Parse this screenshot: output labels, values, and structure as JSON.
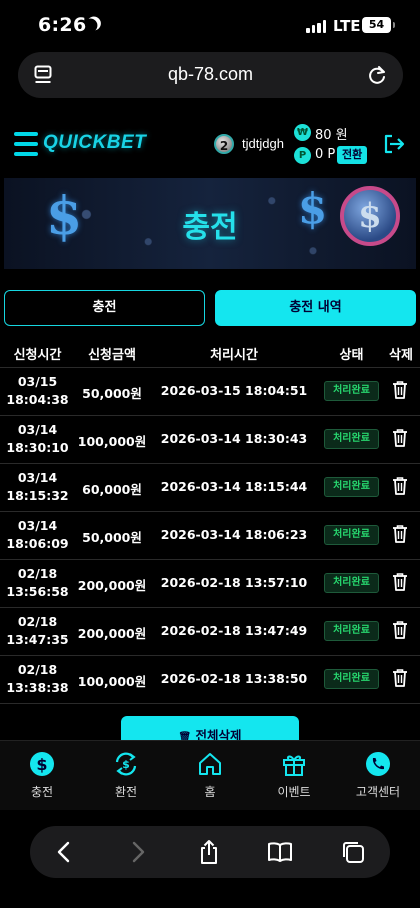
{
  "status_bar": {
    "time": "6:26",
    "network": "LTE",
    "battery": "54"
  },
  "browser": {
    "url": "qb-78.com"
  },
  "header": {
    "logo": "QUICKBET",
    "level": "2",
    "username": "tjdtjdgh",
    "won_symbol": "₩",
    "money": "80 원",
    "point_symbol": "P",
    "points": "0 P",
    "convert_label": "전환"
  },
  "banner": {
    "title": "충전"
  },
  "tabs": [
    {
      "label": "충전",
      "active": false
    },
    {
      "label": "충전 내역",
      "active": true
    }
  ],
  "table": {
    "headers": [
      "신청시간",
      "신청금액",
      "처리시간",
      "상태",
      "삭제"
    ],
    "rows": [
      {
        "date": "03/15",
        "time": "18:04:38",
        "amount": "50,000원",
        "processed": "2026-03-15 18:04:51",
        "status": "처리완료"
      },
      {
        "date": "03/14",
        "time": "18:30:10",
        "amount": "100,000원",
        "processed": "2026-03-14 18:30:43",
        "status": "처리완료"
      },
      {
        "date": "03/14",
        "time": "18:15:32",
        "amount": "60,000원",
        "processed": "2026-03-14 18:15:44",
        "status": "처리완료"
      },
      {
        "date": "03/14",
        "time": "18:06:09",
        "amount": "50,000원",
        "processed": "2026-03-14 18:06:23",
        "status": "처리완료"
      },
      {
        "date": "02/18",
        "time": "13:56:58",
        "amount": "200,000원",
        "processed": "2026-02-18 13:57:10",
        "status": "처리완료"
      },
      {
        "date": "02/18",
        "time": "13:47:35",
        "amount": "200,000원",
        "processed": "2026-02-18 13:47:49",
        "status": "처리완료"
      },
      {
        "date": "02/18",
        "time": "13:38:38",
        "amount": "100,000원",
        "processed": "2026-02-18 13:38:50",
        "status": "처리완료"
      }
    ]
  },
  "delete_all_label": "전체삭제",
  "bottom_nav": [
    {
      "label": "충전",
      "icon": "dollar-circle-icon"
    },
    {
      "label": "환전",
      "icon": "exchange-icon"
    },
    {
      "label": "홈",
      "icon": "home-icon"
    },
    {
      "label": "이벤트",
      "icon": "gift-icon"
    },
    {
      "label": "고객센터",
      "icon": "phone-icon"
    }
  ],
  "colors": {
    "accent": "#14e6ef",
    "status_green": "#27d66e",
    "background": "#000000"
  }
}
